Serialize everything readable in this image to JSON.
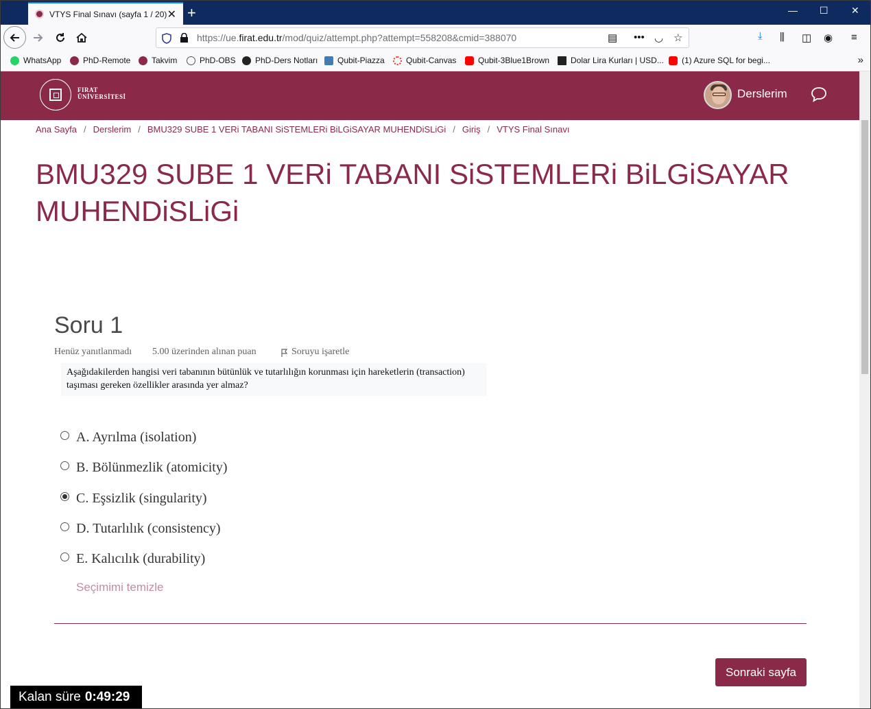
{
  "browser": {
    "tab_title": "VTYS Final Sınavı (sayfa 1 / 20)",
    "tab_close": "✕",
    "new_tab": "+",
    "url_prefix": "https://ue.",
    "url_domain": "firat.edu.tr",
    "url_path": "/mod/quiz/attempt.php?attempt=558208&cmid=388070",
    "window_controls": {
      "minimize": "—",
      "maximize": "☐",
      "close": "✕"
    }
  },
  "bookmarks": [
    {
      "label": "WhatsApp",
      "color": "#25d366"
    },
    {
      "label": "PhD-Remote",
      "color": "#8b2a48"
    },
    {
      "label": "Takvim",
      "color": "#8b2a48"
    },
    {
      "label": "PhD-OBS",
      "color": "#555555"
    },
    {
      "label": "PhD-Ders Notları",
      "color": "#222222"
    },
    {
      "label": "Qubit-Piazza",
      "color": "#3e7cb1"
    },
    {
      "label": "Qubit-Canvas",
      "color": "#e2411f"
    },
    {
      "label": "Qubit-3Blue1Brown",
      "color": "#ff0000"
    },
    {
      "label": "Dolar Lira Kurları | USD...",
      "color": "#222222"
    },
    {
      "label": "(1) Azure SQL for begi...",
      "color": "#ff0000"
    }
  ],
  "site": {
    "logo_line1": "FIRAT",
    "logo_line2": "ÜNİVERSİTESİ",
    "user_menu": "Derslerim",
    "brand_color": "#8b2a48"
  },
  "breadcrumb": [
    "Ana Sayfa",
    "Derslerim",
    "BMU329 SUBE 1 VERi TABANI SiSTEMLERi BiLGiSAYAR MUHENDiSLiGi",
    "Giriş",
    "VTYS Final Sınavı"
  ],
  "breadcrumb_sep": "/",
  "course_title": "BMU329 SUBE 1 VERi TABANI SiSTEMLERi BiLGiSAYAR MUHENDiSLiGi",
  "question": {
    "heading": "Soru 1",
    "status": "Henüz yanıtlanmadı",
    "points": "5.00 üzerinden alınan puan",
    "flag_label": "Soruyu işaretle",
    "text_line1": "Aşağıdakilerden hangisi veri tabanının bütünlük ve tutarlılığın korunması için hareketlerin (transaction)",
    "text_line2": "taşıması gereken özellikler arasında yer almaz?",
    "options": [
      {
        "label": "A. Ayrılma (isolation)",
        "selected": false
      },
      {
        "label": "B. Bölünmezlik (atomicity)",
        "selected": false
      },
      {
        "label": "C. Eşsizlik (singularity)",
        "selected": true
      },
      {
        "label": "D. Tutarlılık (consistency)",
        "selected": false
      },
      {
        "label": "E. Kalıcılık (durability)",
        "selected": false
      }
    ],
    "clear_choice": "Seçimimi temizle"
  },
  "next_page_button": "Sonraki sayfa",
  "timer": {
    "label": "Kalan süre",
    "value": "0:49:29"
  }
}
